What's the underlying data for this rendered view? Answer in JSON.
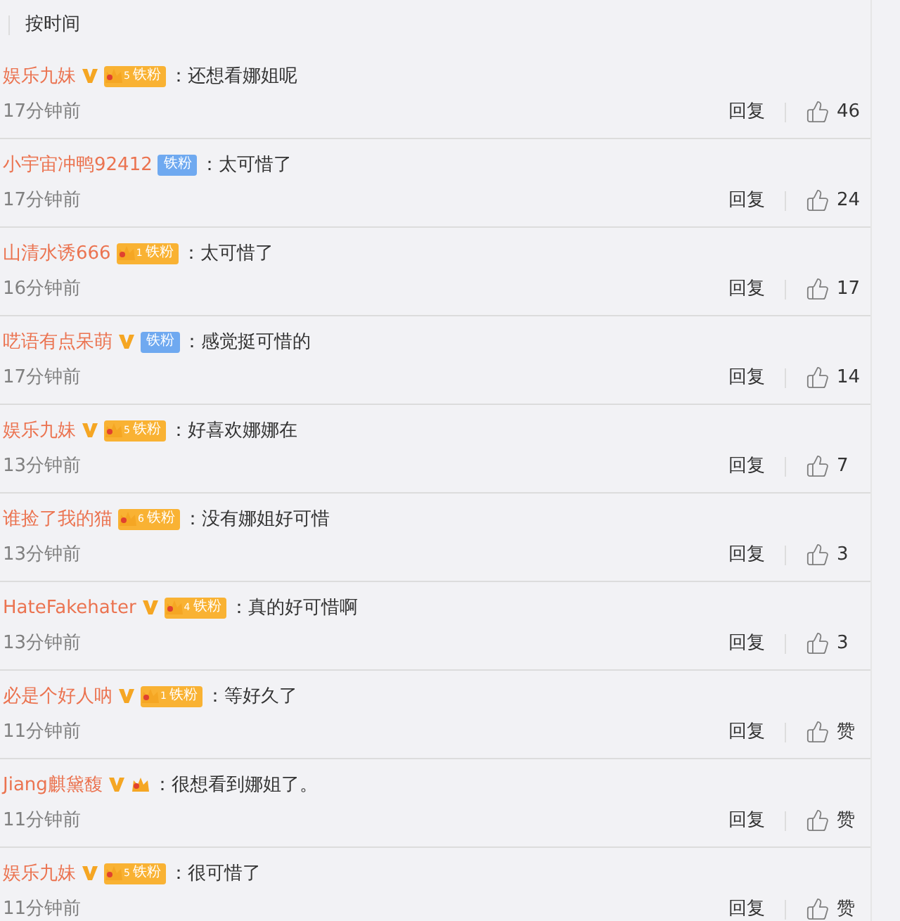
{
  "sort_label": "按时间",
  "comments": [
    {
      "user": "娱乐九妹",
      "verified": true,
      "badge": {
        "kind": "gold",
        "rank": "5",
        "label": "铁粉"
      },
      "text": "：还想看娜姐呢",
      "time": "17分钟前",
      "reply": "回复",
      "likes": "46"
    },
    {
      "user": "小宇宙冲鸭92412",
      "verified": false,
      "badge": {
        "kind": "blue",
        "label": "铁粉"
      },
      "text": "：太可惜了",
      "time": "17分钟前",
      "reply": "回复",
      "likes": "24"
    },
    {
      "user": "山清水诱666",
      "verified": false,
      "badge": {
        "kind": "gold",
        "rank": "1",
        "label": "铁粉"
      },
      "text": "：太可惜了",
      "time": "16分钟前",
      "reply": "回复",
      "likes": "17"
    },
    {
      "user": "呓语有点呆萌",
      "verified": true,
      "badge": {
        "kind": "blue",
        "label": "铁粉"
      },
      "text": "：感觉挺可惜的",
      "time": "17分钟前",
      "reply": "回复",
      "likes": "14"
    },
    {
      "user": "娱乐九妹",
      "verified": true,
      "badge": {
        "kind": "gold",
        "rank": "5",
        "label": "铁粉"
      },
      "text": "：好喜欢娜娜在",
      "time": "13分钟前",
      "reply": "回复",
      "likes": "7"
    },
    {
      "user": "谁捡了我的猫",
      "verified": false,
      "badge": {
        "kind": "gold",
        "rank": "6",
        "label": "铁粉"
      },
      "text": "：没有娜姐好可惜",
      "time": "13分钟前",
      "reply": "回复",
      "likes": "3"
    },
    {
      "user": "HateFakehater",
      "verified": true,
      "badge": {
        "kind": "gold",
        "rank": "4",
        "label": "铁粉"
      },
      "text": "：真的好可惜啊",
      "time": "13分钟前",
      "reply": "回复",
      "likes": "3"
    },
    {
      "user": "必是个好人呐",
      "verified": true,
      "badge": {
        "kind": "gold",
        "rank": "1",
        "label": "铁粉"
      },
      "text": "：等好久了",
      "time": "11分钟前",
      "reply": "回复",
      "likes": "赞"
    },
    {
      "user": "Jiang麒黛馥",
      "verified": true,
      "badge": {
        "kind": "crown"
      },
      "text": "：很想看到娜姐了。",
      "time": "11分钟前",
      "reply": "回复",
      "likes": "赞"
    },
    {
      "user": "娱乐九妹",
      "verified": true,
      "badge": {
        "kind": "gold",
        "rank": "5",
        "label": "铁粉"
      },
      "text": "：很可惜了",
      "time": "11分钟前",
      "reply": "回复",
      "likes": "赞"
    }
  ]
}
